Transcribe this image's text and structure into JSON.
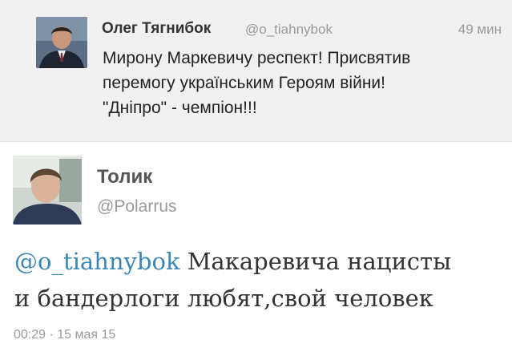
{
  "parent_tweet": {
    "author_name": "Олег Тягнибок",
    "handle": "@o_tiahnybok",
    "time_ago": "49 мин",
    "text_lines": [
      "Мирону Маркевичу респект! Присвятив",
      "перемогу українським Героям війни!",
      "\"Дніпро\" - чемпіон!!!"
    ]
  },
  "main_tweet": {
    "author_name": "Толик",
    "handle": "@Polarrus",
    "mention": "@o_tiahnybok",
    "text_line1_rest": " Макаревича нацисты",
    "text_line2": "и бандерлоги любят,свой человек",
    "timestamp": "00:29 · 15 мая 15"
  },
  "colors": {
    "mention": "#3a86b6",
    "parent_background": "#f1f1f1",
    "meta_text": "#9a9a9a"
  }
}
